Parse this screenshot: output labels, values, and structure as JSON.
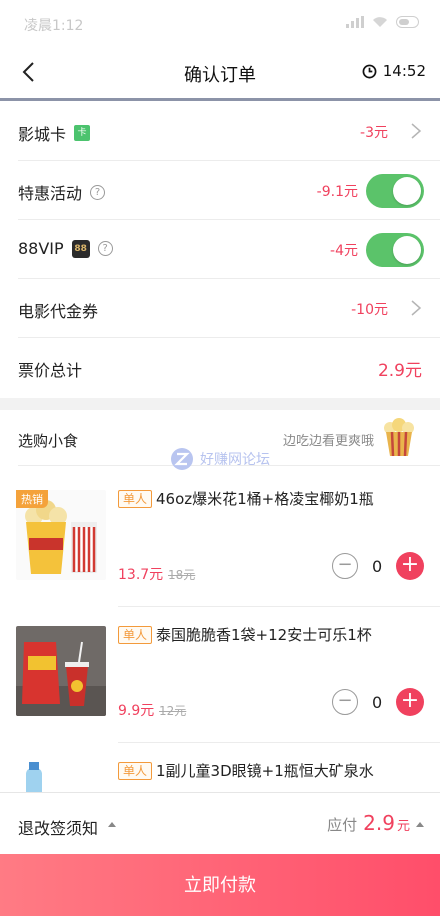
{
  "status_bar": {
    "time": "凌晨1:12"
  },
  "nav": {
    "title": "确认订单",
    "countdown": "14:52"
  },
  "discounts": [
    {
      "label": "影城卡",
      "badge": "卡",
      "value": "-3元"
    },
    {
      "label": "特惠活动",
      "help": "?",
      "value": "-9.1元",
      "toggle": true
    },
    {
      "label": "88VIP",
      "badge": "88",
      "help": "?",
      "value": "-4元",
      "toggle": true
    },
    {
      "label": "电影代金券",
      "value": "-10元"
    }
  ],
  "total": {
    "label": "票价总计",
    "value": "2.9元"
  },
  "snacks": {
    "title": "选购小食",
    "slogan": "边吃边看更爽哦",
    "watermark": "好赚网论坛",
    "items": [
      {
        "hot_tag": "热销",
        "single_tag": "单人",
        "name": "46oz爆米花1桶+格凌宝椰奶1瓶",
        "price": "13.7元",
        "original": "18元",
        "qty": "0"
      },
      {
        "single_tag": "单人",
        "name": "泰国脆脆香1袋+12安士可乐1杯",
        "price": "9.9元",
        "original": "12元",
        "qty": "0"
      },
      {
        "single_tag": "单人",
        "name": "1副儿童3D眼镜+1瓶恒大矿泉水"
      }
    ]
  },
  "bottom": {
    "notice": "退改签须知",
    "pay_label": "应付",
    "pay_amount": "2.9",
    "pay_unit": "元",
    "pay_button": "立即付款"
  },
  "colors": {
    "accent": "#f0415e",
    "toggle_on": "#5bc36a",
    "badge_orange": "#f39a3b"
  }
}
